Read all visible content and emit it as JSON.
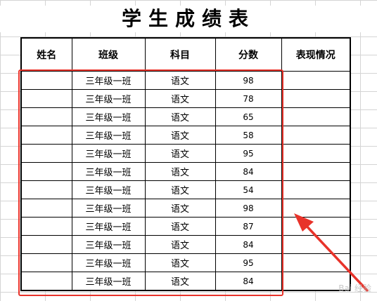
{
  "sheet": {
    "title": "学生成绩表",
    "headers": [
      "姓名",
      "班级",
      "科目",
      "分数",
      "表现情况"
    ],
    "rows": [
      {
        "name": "",
        "class": "三年级一班",
        "subject": "语文",
        "score": "98",
        "performance": ""
      },
      {
        "name": "",
        "class": "三年级一班",
        "subject": "语文",
        "score": "78",
        "performance": ""
      },
      {
        "name": "",
        "class": "三年级一班",
        "subject": "语文",
        "score": "65",
        "performance": ""
      },
      {
        "name": "",
        "class": "三年级一班",
        "subject": "语文",
        "score": "58",
        "performance": ""
      },
      {
        "name": "",
        "class": "三年级一班",
        "subject": "语文",
        "score": "95",
        "performance": ""
      },
      {
        "name": "",
        "class": "三年级一班",
        "subject": "语文",
        "score": "84",
        "performance": ""
      },
      {
        "name": "",
        "class": "三年级一班",
        "subject": "语文",
        "score": "54",
        "performance": ""
      },
      {
        "name": "",
        "class": "三年级一班",
        "subject": "语文",
        "score": "98",
        "performance": ""
      },
      {
        "name": "",
        "class": "三年级一班",
        "subject": "语文",
        "score": "87",
        "performance": ""
      },
      {
        "name": "",
        "class": "三年级一班",
        "subject": "语文",
        "score": "84",
        "performance": ""
      },
      {
        "name": "",
        "class": "三年级一班",
        "subject": "语文",
        "score": "95",
        "performance": ""
      },
      {
        "name": "",
        "class": "三年级一班",
        "subject": "语文",
        "score": "84",
        "performance": ""
      }
    ]
  },
  "annotation": {
    "highlight_color": "#e8332a"
  },
  "watermark": {
    "text": "Bai 经验"
  }
}
